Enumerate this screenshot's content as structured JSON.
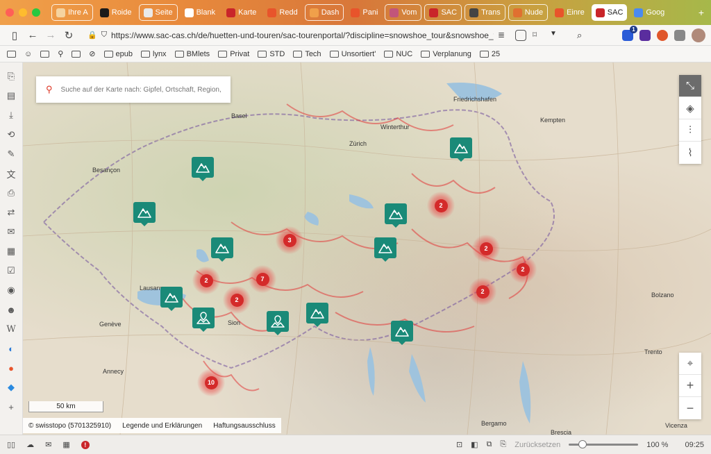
{
  "browser": {
    "tabs": [
      {
        "label": "Ihre A",
        "framed": true
      },
      {
        "label": "Roide",
        "framed": false
      },
      {
        "label": "Seite",
        "framed": true
      },
      {
        "label": "Blank",
        "framed": false
      },
      {
        "label": "Karte",
        "framed": false
      },
      {
        "label": "Redd",
        "framed": false
      },
      {
        "label": "Dash",
        "framed": true
      },
      {
        "label": "Pani",
        "framed": false
      },
      {
        "label": "Vom",
        "framed": true
      },
      {
        "label": "SAC",
        "framed": true
      },
      {
        "label": "Trans",
        "framed": true
      },
      {
        "label": "Nude",
        "framed": true
      },
      {
        "label": "Einre",
        "framed": false
      },
      {
        "label": "SAC",
        "framed": false,
        "active": true
      },
      {
        "label": "Goog",
        "framed": false
      }
    ],
    "url": "https://www.sac-cas.ch/de/huetten-und-touren/sac-tourenportal/?discipline=snowshoe_tour&snowshoe_tour...",
    "bookmarks": [
      "epub",
      "lynx",
      "BMlets",
      "Privat",
      "STD",
      "Tech",
      "Unsortiert'",
      "NUC",
      "Verplanung",
      "25"
    ],
    "extension_badge": "1"
  },
  "map": {
    "search_placeholder": "Suche auf der Karte nach: Gipfel, Ortschaft, Region, ...",
    "scale_label": "50 km",
    "attribution": [
      "© swisstopo (5701325910)",
      "Legende und Erklärungen",
      "Haftungsausschluss"
    ],
    "labels": [
      {
        "text": "Basel",
        "id": "basel"
      },
      {
        "text": "Zürich",
        "id": "zurich"
      },
      {
        "text": "Winterthur",
        "id": "winterthur"
      },
      {
        "text": "Besançon",
        "id": "besancon"
      },
      {
        "text": "Lausanne",
        "id": "lausanne"
      },
      {
        "text": "Genève",
        "id": "geneve"
      },
      {
        "text": "Annecy",
        "id": "annecy"
      },
      {
        "text": "Sion",
        "id": "sion"
      },
      {
        "text": "Trento",
        "id": "trento"
      },
      {
        "text": "Bergamo",
        "id": "bergamo"
      },
      {
        "text": "Brescia",
        "id": "brescia"
      },
      {
        "text": "Bolzano",
        "id": "bolzano"
      },
      {
        "text": "Friedrichshafen",
        "id": "friedrichshafen"
      },
      {
        "text": "Kempten",
        "id": "kempten"
      },
      {
        "text": "Vicenza",
        "id": "vicenza"
      }
    ],
    "clusters": [
      {
        "count": "2",
        "id": "c1"
      },
      {
        "count": "3",
        "id": "c2"
      },
      {
        "count": "2",
        "id": "c3"
      },
      {
        "count": "2",
        "id": "c4"
      },
      {
        "count": "2",
        "id": "c5"
      },
      {
        "count": "7",
        "id": "c6"
      },
      {
        "count": "2",
        "id": "c7"
      },
      {
        "count": "2",
        "id": "c8"
      },
      {
        "count": "10",
        "id": "c9"
      }
    ],
    "markers": [
      {
        "icon": "mountain-icon",
        "id": "m1"
      },
      {
        "icon": "mountain-icon",
        "id": "m2"
      },
      {
        "icon": "mountain-icon",
        "id": "m3"
      },
      {
        "icon": "mountain-icon",
        "id": "m4"
      },
      {
        "icon": "mountain-icon",
        "id": "m5"
      },
      {
        "icon": "mountain-icon",
        "id": "m6"
      },
      {
        "icon": "mountain-icon",
        "id": "m7"
      },
      {
        "icon": "mountain-icon",
        "id": "m8"
      },
      {
        "icon": "pin-mountain-icon",
        "id": "m9"
      },
      {
        "icon": "pin-mountain-icon",
        "id": "m10"
      },
      {
        "icon": "mountain-icon",
        "id": "m11"
      }
    ],
    "colors": {
      "marker": "#1a8a78",
      "cluster": "#d42a2a",
      "route": "#e23a3a"
    }
  },
  "statusbar": {
    "reset_label": "Zurücksetzen",
    "zoom": "100 %",
    "zoom_fraction": 0.2,
    "time": "09:25"
  }
}
